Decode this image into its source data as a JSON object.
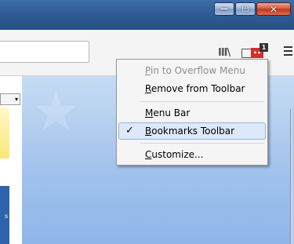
{
  "window": {
    "minimize_label": "—",
    "maximize_label": "▢",
    "close_label": "✕"
  },
  "toolbar": {
    "library_icon": "III\\",
    "extension_badge": "1",
    "extension_label": "••"
  },
  "context_menu": {
    "items": [
      {
        "key": "P",
        "rest": "in to Overflow Menu",
        "disabled": true
      },
      {
        "key": "R",
        "rest": "emove from Toolbar",
        "disabled": false
      },
      {
        "key": "M",
        "rest": "enu Bar",
        "disabled": false
      },
      {
        "key": "B",
        "rest": "ookmarks Toolbar",
        "disabled": false,
        "checked": true
      },
      {
        "key": "C",
        "rest": "ustomize...",
        "disabled": false
      }
    ],
    "check_mark": "✓"
  },
  "content": {
    "left_dropdown_arrow": "▾",
    "left_strip_text": "s"
  },
  "colors": {
    "titlebar": "#2f5c95",
    "menu_highlight": "#dde9f8",
    "extension_red": "#d82b2b"
  }
}
